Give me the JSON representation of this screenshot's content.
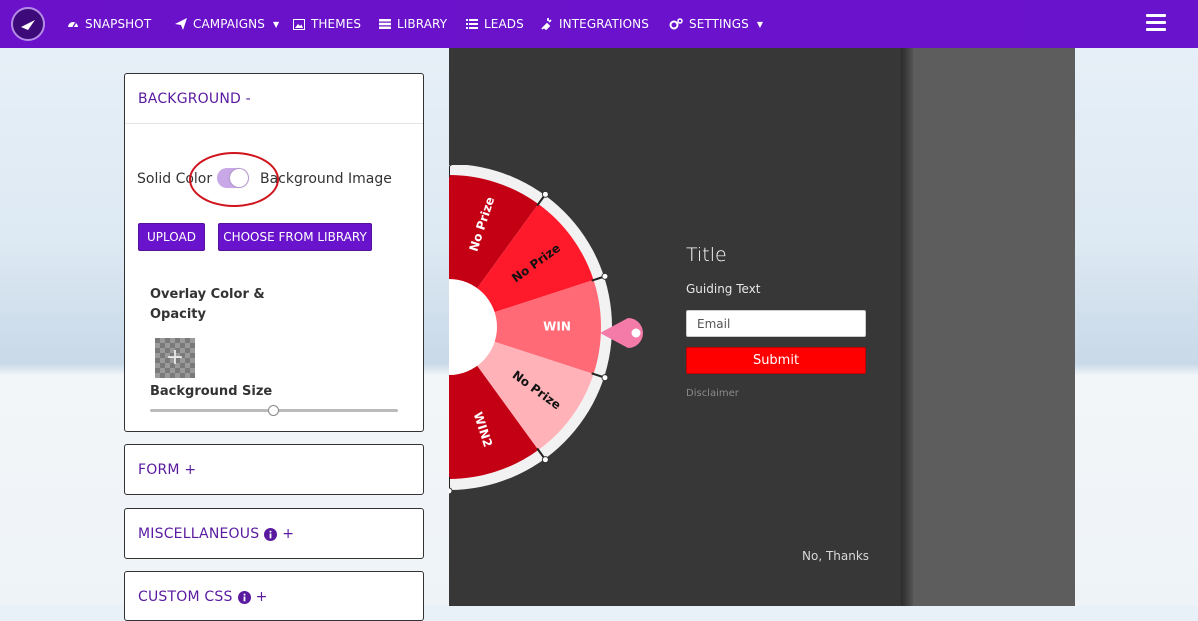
{
  "nav": {
    "items": [
      {
        "label": "SNAPSHOT",
        "icon": "dashboard-icon"
      },
      {
        "label": "CAMPAIGNS",
        "icon": "paper-plane-icon",
        "dropdown": true
      },
      {
        "label": "THEMES",
        "icon": "image-icon"
      },
      {
        "label": "LIBRARY",
        "icon": "library-icon"
      },
      {
        "label": "LEADS",
        "icon": "list-icon"
      },
      {
        "label": "INTEGRATIONS",
        "icon": "plug-icon"
      },
      {
        "label": "SETTINGS",
        "icon": "gears-icon",
        "dropdown": true
      }
    ]
  },
  "background_panel": {
    "title": "BACKGROUND -",
    "solid_color_label": "Solid Color",
    "background_image_label": "Background Image",
    "toggle_on": true,
    "upload_label": "UPLOAD",
    "choose_library_label": "CHOOSE FROM LIBRARY",
    "overlay_label": "Overlay Color & Opacity",
    "overlay_plus": "+",
    "background_size_label": "Background Size",
    "background_size_level": 0.5
  },
  "form_panel": {
    "title": "FORM +"
  },
  "misc_panel": {
    "title": "MISCELLANEOUS",
    "suffix": "+"
  },
  "css_panel": {
    "title": "CUSTOM CSS",
    "suffix": "+"
  },
  "preview": {
    "title": "Title",
    "guiding_text": "Guiding Text",
    "email_placeholder": "Email",
    "submit_label": "Submit",
    "disclaimer": "Disclaimer",
    "no_thanks": "No, Thanks",
    "wheel_labels": [
      "No Prize",
      "No Prize",
      "No Prize",
      "WIN",
      "No Prize",
      "WIN2",
      "No Prize"
    ]
  },
  "colors": {
    "nav": "#6a11c9",
    "accent_purple": "#6a13cc",
    "submit_red": "#ff0000",
    "preview_bg": "#373737"
  }
}
